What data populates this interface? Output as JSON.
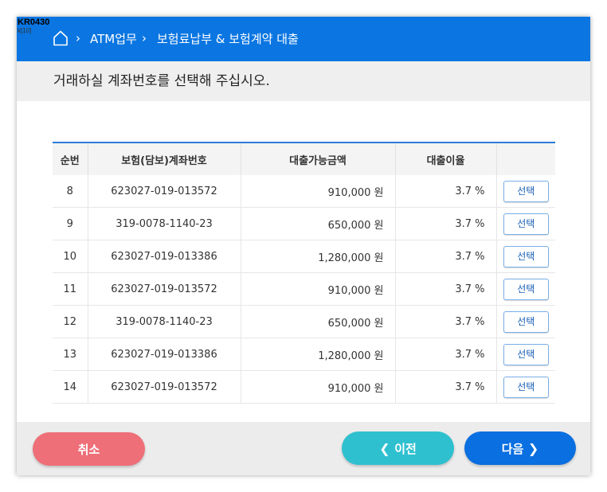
{
  "screen": {
    "code": "KR0430",
    "sub_code": "k[10]"
  },
  "header": {
    "breadcrumb": [
      {
        "label": "ATM업무"
      },
      {
        "label": "보험료납부 & 보험계약 대출"
      }
    ]
  },
  "instruction": "거래하실 계좌번호를 선택해 주십시오.",
  "table": {
    "columns": [
      "순번",
      "보험(담보)계좌번호",
      "대출가능금액",
      "대출이율",
      ""
    ],
    "rows": [
      {
        "no": "8",
        "account": "623027-019-013572",
        "amount": "910,000 원",
        "rate": "3.7 %",
        "action": "선택"
      },
      {
        "no": "9",
        "account": "319-0078-1140-23",
        "amount": "650,000 원",
        "rate": "3.7 %",
        "action": "선택"
      },
      {
        "no": "10",
        "account": "623027-019-013386",
        "amount": "1,280,000 원",
        "rate": "3.7 %",
        "action": "선택"
      },
      {
        "no": "11",
        "account": "623027-019-013572",
        "amount": "910,000 원",
        "rate": "3.7 %",
        "action": "선택"
      },
      {
        "no": "12",
        "account": "319-0078-1140-23",
        "amount": "650,000 원",
        "rate": "3.7 %",
        "action": "선택"
      },
      {
        "no": "13",
        "account": "623027-019-013386",
        "amount": "1,280,000 원",
        "rate": "3.7 %",
        "action": "선택"
      },
      {
        "no": "14",
        "account": "623027-019-013572",
        "amount": "910,000 원",
        "rate": "3.7 %",
        "action": "선택"
      }
    ]
  },
  "footer": {
    "cancel_label": "취소",
    "prev_label": "이전",
    "next_label": "다음"
  },
  "colors": {
    "header": "#0b76e1",
    "cancel": "#ee6f78",
    "prev": "#2fc0cf",
    "next": "#0a6fe0"
  }
}
